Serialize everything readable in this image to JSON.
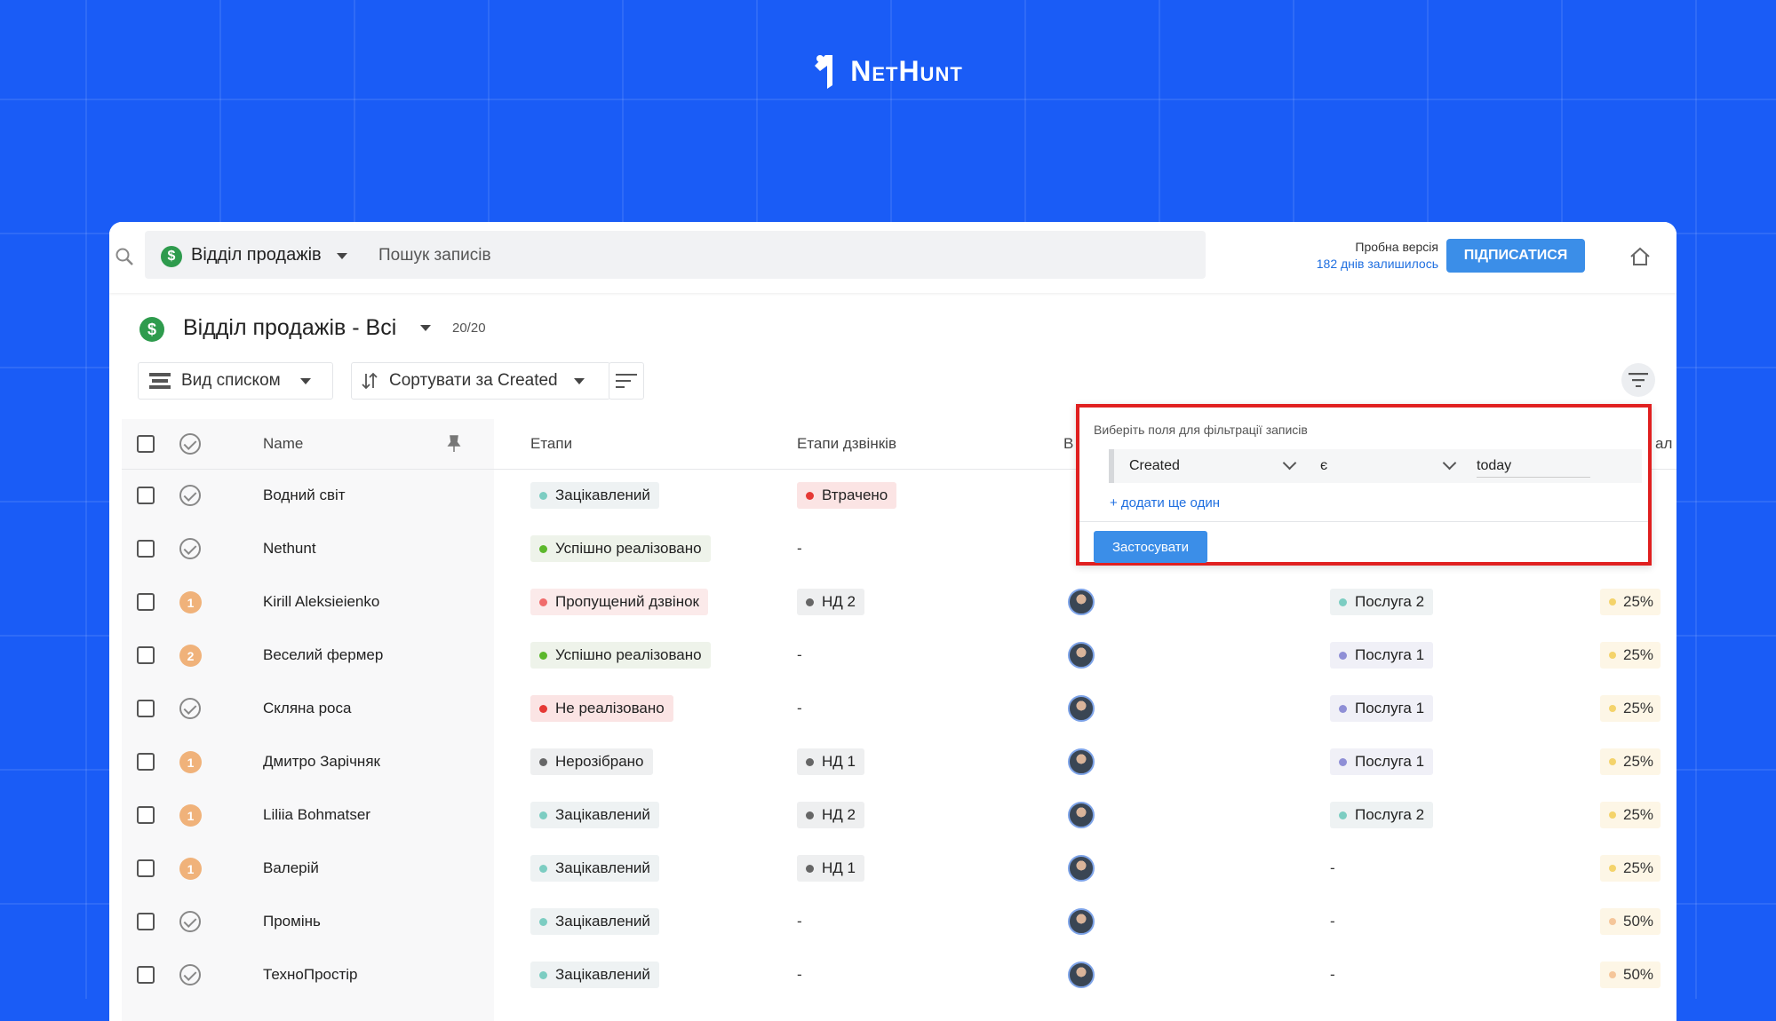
{
  "brand": {
    "name": "NetHunt"
  },
  "search": {
    "database": "Відділ продажів",
    "placeholder": "Пошук записів"
  },
  "trial": {
    "label": "Пробна версія",
    "days_left": "182 днів залишилось",
    "subscribe": "ПІДПИСАТИСЯ"
  },
  "view": {
    "title": "Відділ продажів - Всі",
    "count": "20/20",
    "list_mode": "Вид списком",
    "sort": "Сортувати за Created"
  },
  "columns": {
    "name": "Name",
    "stages": "Етапи",
    "call_stages": "Етапи дзвінків",
    "col_b": "В",
    "col_last": "ал"
  },
  "rows": [
    {
      "name": "Водний світ",
      "status": "done",
      "stage": "Зацікавлений",
      "call": "Втрачено",
      "service": "",
      "pct": ""
    },
    {
      "name": "Nethunt",
      "status": "done",
      "stage": "Успішно реалізовано",
      "call": "-",
      "service": "",
      "pct": ""
    },
    {
      "name": "Kirill Aleksieienko",
      "status": "1",
      "stage": "Пропущений дзвінок",
      "call": "НД 2",
      "service": "Послуга 2",
      "pct": "25%"
    },
    {
      "name": "Веселий фермер",
      "status": "2",
      "stage": "Успішно реалізовано",
      "call": "-",
      "service": "Послуга 1",
      "pct": "25%"
    },
    {
      "name": "Скляна роса",
      "status": "done",
      "stage": "Не реалізовано",
      "call": "-",
      "service": "Послуга 1",
      "pct": "25%"
    },
    {
      "name": "Дмитро Зарічняк",
      "status": "1",
      "stage": "Нерозібрано",
      "call": "НД 1",
      "service": "Послуга 1",
      "pct": "25%"
    },
    {
      "name": "Liliia Bohmatser",
      "status": "1",
      "stage": "Зацікавлений",
      "call": "НД 2",
      "service": "Послуга 2",
      "pct": "25%"
    },
    {
      "name": "Валерій",
      "status": "1",
      "stage": "Зацікавлений",
      "call": "НД 1",
      "service": "-",
      "pct": "25%"
    },
    {
      "name": "Промінь",
      "status": "done",
      "stage": "Зацікавлений",
      "call": "-",
      "service": "-",
      "pct": "50%"
    },
    {
      "name": "ТехноПростір",
      "status": "done",
      "stage": "Зацікавлений",
      "call": "-",
      "service": "-",
      "pct": "50%"
    }
  ],
  "filter": {
    "title": "Виберіть поля для фільтрації записів",
    "field": "Created",
    "operator": "є",
    "value": "today",
    "add_more": "+ додати ще один",
    "apply": "Застосувати"
  },
  "colors": {
    "background": "#1a5cf6",
    "accent": "#3b8ee8",
    "highlight": "#e02020",
    "stage_interested": "#7ccdc2",
    "stage_success": "#5cb82c",
    "stage_missed": "#f06b6b",
    "stage_failed": "#e53935",
    "stage_unsorted": "#666666",
    "call_lost": "#e53935",
    "service_2": "#7ccdc2",
    "service_1": "#8f8fd6",
    "pct_25": "#f4d36b",
    "pct_50": "#f5c69a"
  },
  "icons": {
    "search": "search-icon",
    "home": "home-icon",
    "filter": "filter-icon",
    "pin": "pin-icon",
    "sort": "sort-icon"
  }
}
